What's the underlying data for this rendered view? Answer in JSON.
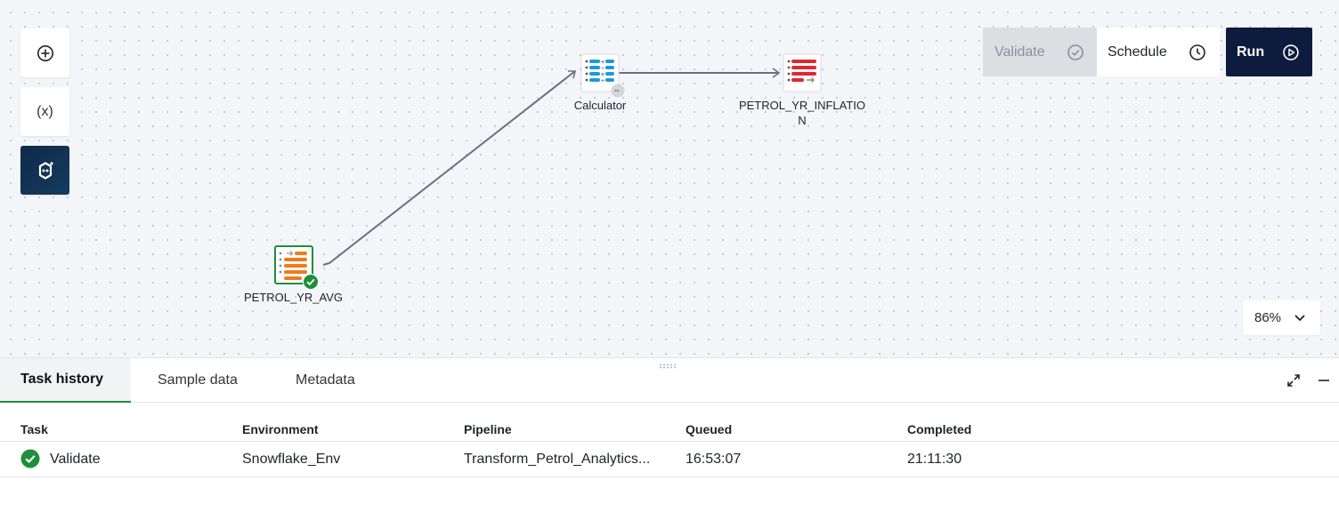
{
  "toolbar": {
    "add_icon": "plus-circle-icon",
    "variables_label": "(x)",
    "assistant_icon": "ai-assistant-icon"
  },
  "actions": {
    "validate_label": "Validate",
    "schedule_label": "Schedule",
    "run_label": "Run"
  },
  "nodes": {
    "source": {
      "label": "PETROL_YR_AVG",
      "status": "success"
    },
    "calculator": {
      "label": "Calculator"
    },
    "target": {
      "label_line1": "PETROL_YR_INFLATIO",
      "label_line2": "N"
    }
  },
  "zoom": {
    "value": "86%"
  },
  "panel": {
    "tabs": [
      "Task history",
      "Sample data",
      "Metadata"
    ],
    "columns": [
      "Task",
      "Environment",
      "Pipeline",
      "Queued",
      "Completed"
    ],
    "rows": [
      {
        "task": "Validate",
        "status": "success",
        "environment": "Snowflake_Env",
        "pipeline": "Transform_Petrol_Analytics...",
        "queued": "16:53:07",
        "completed": "21:11:30"
      }
    ]
  },
  "colors": {
    "run_bg": "#0d1b3e",
    "success": "#1e8e3e",
    "source_accent": "#f07a1a",
    "calculator_accent": "#1a9ad9",
    "target_accent": "#e0282e"
  }
}
